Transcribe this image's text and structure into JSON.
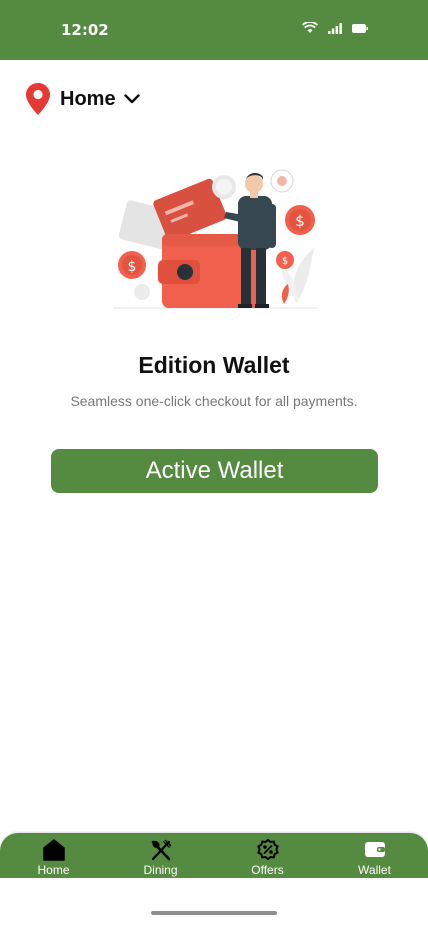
{
  "status_bar": {
    "time": "12:02",
    "icons": [
      "wifi-icon",
      "signal-icon",
      "battery-icon"
    ]
  },
  "location": {
    "label": "Home",
    "icon": "location-pin-icon",
    "dropdown_icon": "chevron-down-icon"
  },
  "wallet": {
    "title": "Edition Wallet",
    "subtitle": "Seamless one-click checkout for all payments.",
    "cta_label": "Active Wallet"
  },
  "bottom_nav": {
    "items": [
      {
        "label": "Home",
        "icon": "home-icon"
      },
      {
        "label": "Dining",
        "icon": "dining-icon"
      },
      {
        "label": "Offers",
        "icon": "offers-icon"
      },
      {
        "label": "Wallet",
        "icon": "wallet-icon"
      }
    ]
  },
  "colors": {
    "primary": "#558a41",
    "pin": "#e53935",
    "illustration_accent": "#f1604c"
  }
}
